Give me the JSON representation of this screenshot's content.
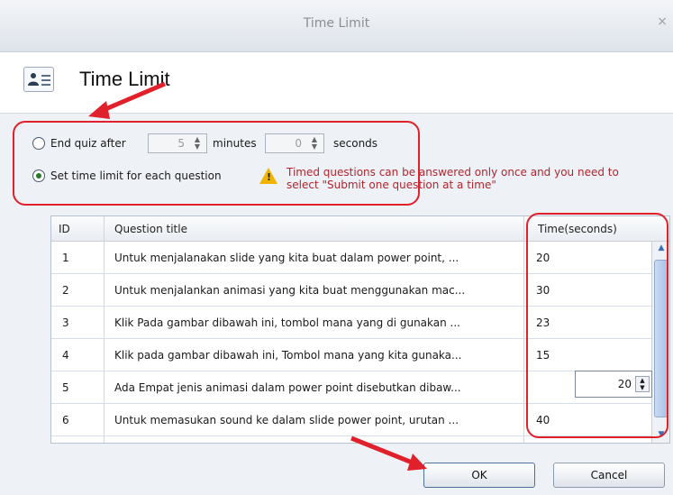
{
  "window": {
    "title": "Time Limit",
    "close_glyph": "×"
  },
  "header": {
    "icon": "contact-card-icon",
    "title": "Time Limit"
  },
  "options": {
    "end_quiz": {
      "label": "End quiz after",
      "selected": false,
      "minutes_value": "5",
      "minutes_label": "minutes",
      "seconds_value": "0",
      "seconds_label": "seconds"
    },
    "per_question": {
      "label": "Set time limit for each question",
      "selected": true
    },
    "warning": {
      "icon": "warning-icon",
      "line1": "Timed questions can be answered only once and you need to",
      "line2": "select \"Submit one question at a time\""
    }
  },
  "table": {
    "columns": [
      "ID",
      "Question title",
      "Time(seconds)"
    ],
    "rows": [
      {
        "id": "1",
        "title": "Untuk menjalanakan slide yang kita buat dalam power point, ...",
        "time": "20"
      },
      {
        "id": "2",
        "title": "Untuk menjalankan animasi yang kita buat menggunakan mac...",
        "time": "30"
      },
      {
        "id": "3",
        "title": "Klik Pada gambar dibawah ini, tombol mana yang di gunakan ...",
        "time": "23"
      },
      {
        "id": "4",
        "title": "Klik pada gambar dibawah ini, Tombol mana yang kita gunaka...",
        "time": "15"
      },
      {
        "id": "5",
        "title": "Ada Empat jenis animasi dalam power point disebutkan dibaw...",
        "time": "20"
      },
      {
        "id": "6",
        "title": "Untuk memasukan sound ke dalam slide power point, urutan ...",
        "time": "40"
      }
    ]
  },
  "buttons": {
    "ok": "OK",
    "cancel": "Cancel"
  },
  "colors": {
    "annotation": "#e0202a",
    "warning_text": "#b0262f",
    "radio_check": "#2b7a2b"
  }
}
